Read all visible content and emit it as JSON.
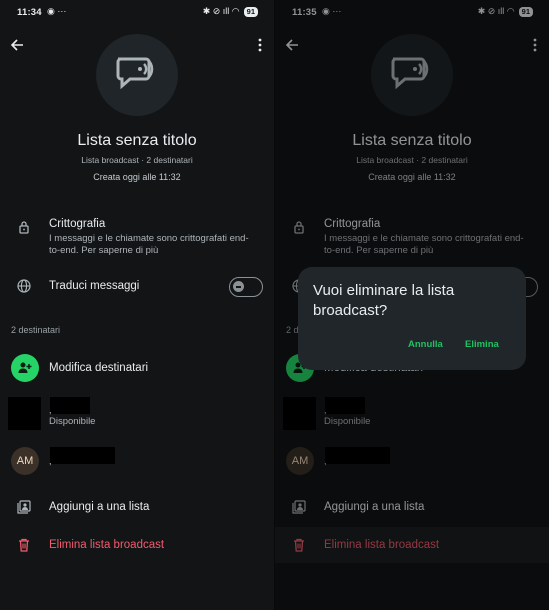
{
  "status_left": {
    "time": "11:34",
    "notif": "◉ ···"
  },
  "status_right": {
    "time": "11:35",
    "notif": "◉ ···"
  },
  "status_icons": "✱ ⊘ ıll ◠",
  "battery": "91",
  "group": {
    "title": "Lista senza titolo",
    "subtitle": "Lista broadcast · 2 destinatari",
    "created": "Creata oggi alle 11:32"
  },
  "encryption": {
    "title": "Crittografia",
    "description": "I messaggi e le chiamate sono crittografati end-to-end. Per saperne di più"
  },
  "translate": {
    "label": "Traduci messaggi",
    "enabled": false
  },
  "recipients_header": "2 destinatari",
  "edit_recipients": "Modifica destinatari",
  "recipients": [
    {
      "name_hidden": ",",
      "status": "Disponibile"
    },
    {
      "initials": "AM",
      "name_hidden": ","
    }
  ],
  "add_to_list": "Aggiungi a una lista",
  "delete_broadcast": "Elimina lista broadcast",
  "dialog": {
    "title": "Vuoi eliminare la lista broadcast?",
    "cancel": "Annulla",
    "confirm": "Elimina"
  },
  "colors": {
    "background": "#121416",
    "accent": "#25d366",
    "danger": "#f15c6d",
    "dialog": "#20262a"
  }
}
